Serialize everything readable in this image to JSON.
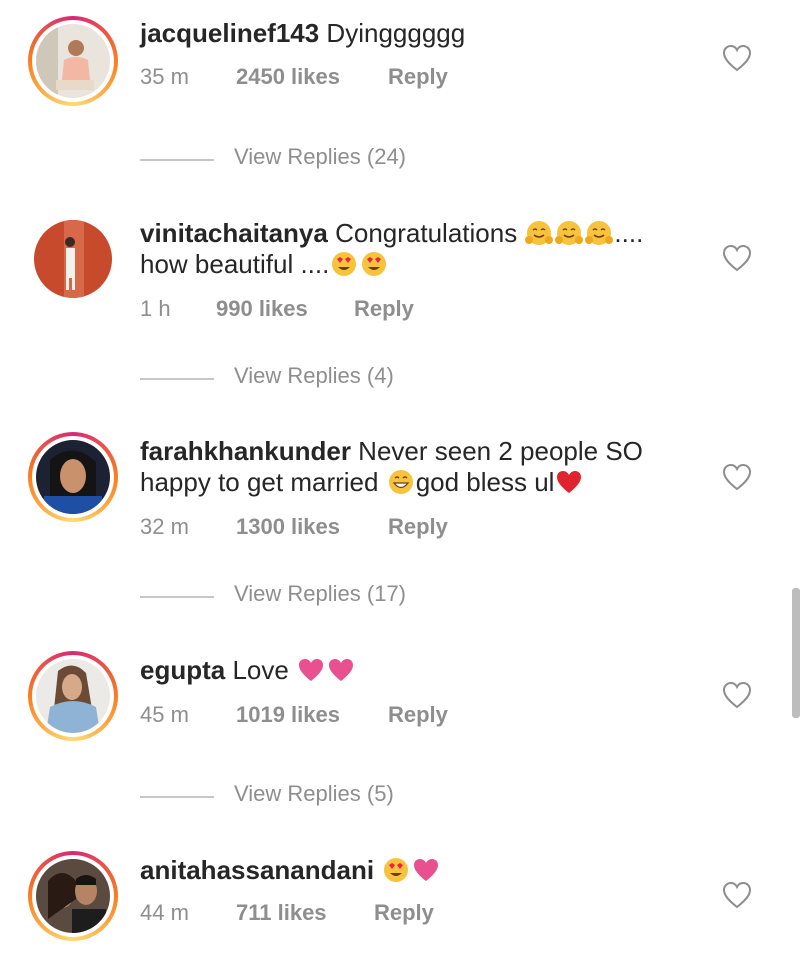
{
  "comments": [
    {
      "username": "jacquelinef143",
      "text": " Dyingggggg",
      "line2": "",
      "time": "35 m",
      "likes": "2450 likes",
      "reply": "Reply",
      "view_replies": "View Replies (24)"
    },
    {
      "username": "vinitachaitanya",
      "text": " Congratulations ",
      "text_suffix": "....",
      "line2": "how beautiful ....",
      "time": "1 h",
      "likes": "990 likes",
      "reply": "Reply",
      "view_replies": "View Replies (4)"
    },
    {
      "username": "farahkhankunder",
      "text": " Never seen 2 people SO",
      "line2": "happy to get married ",
      "line2_suffix": "god bless ul",
      "time": "32 m",
      "likes": "1300 likes",
      "reply": "Reply",
      "view_replies": "View Replies (17)"
    },
    {
      "username": "egupta",
      "text": " Love ",
      "line2": "",
      "time": "45 m",
      "likes": "1019 likes",
      "reply": "Reply",
      "view_replies": "View Replies (5)"
    },
    {
      "username": "anitahassanandani",
      "text": " ",
      "line2": "",
      "time": "44 m",
      "likes": "711 likes",
      "reply": "Reply"
    }
  ],
  "colors": {
    "ring_start": "#d62976",
    "ring_mid": "#fa7e1e",
    "muted": "#8e8e8e",
    "heart_pink": "#e8508f",
    "heart_red": "#e0232e"
  },
  "icons": {
    "like": "heart-outline-icon",
    "emoji_hug": "hugging-face-emoji",
    "emoji_hearteyes": "heart-eyes-emoji",
    "emoji_smile": "grinning-face-emoji"
  }
}
